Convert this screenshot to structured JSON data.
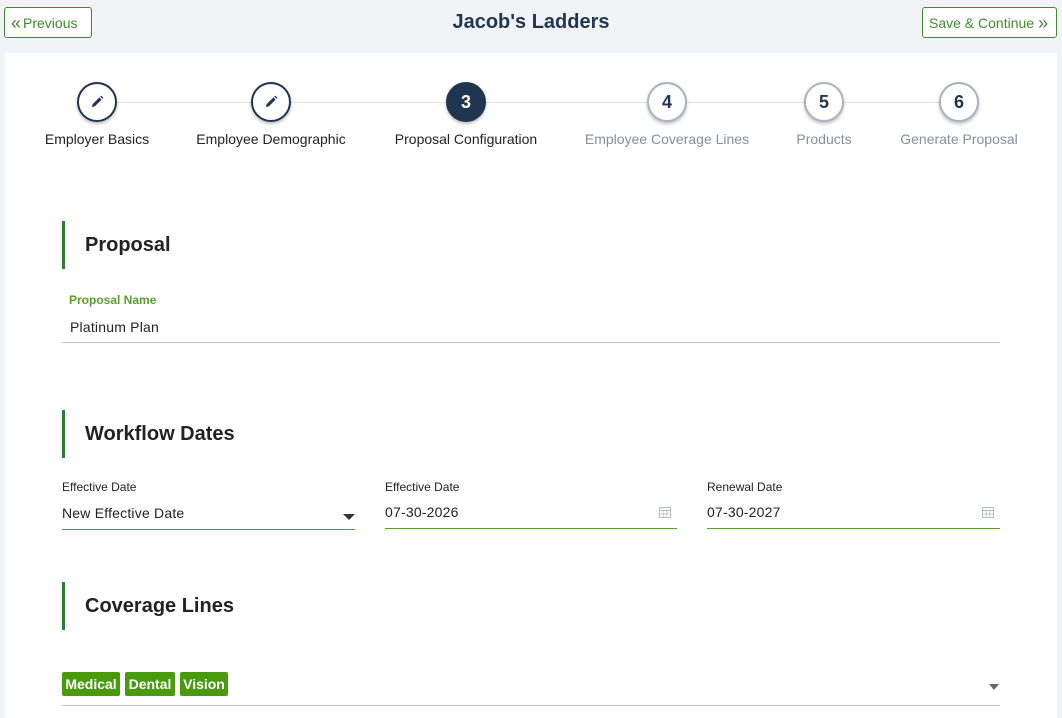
{
  "header": {
    "title": "Jacob's Ladders",
    "prev_label": "Previous",
    "next_label": "Save & Continue",
    "prev_icon": "chevrons-left-icon",
    "next_icon": "chevrons-right-icon"
  },
  "stepper": {
    "steps": [
      {
        "marker": "",
        "icon": "pencil-icon",
        "label": "Employer Basics",
        "state": "done"
      },
      {
        "marker": "",
        "icon": "pencil-icon",
        "label": "Employee Demographic",
        "state": "done"
      },
      {
        "marker": "3",
        "label": "Proposal Configuration",
        "state": "active"
      },
      {
        "marker": "4",
        "label": "Employee Coverage Lines",
        "state": "future"
      },
      {
        "marker": "5",
        "label": "Products",
        "state": "future"
      },
      {
        "marker": "6",
        "label": "Generate Proposal",
        "state": "future"
      }
    ]
  },
  "proposal": {
    "heading": "Proposal",
    "name_label": "Proposal Name",
    "name_value": "Platinum Plan"
  },
  "workflow": {
    "heading": "Workflow Dates",
    "effective_select_label": "Effective Date",
    "effective_select_value": "New Effective Date",
    "effective_date_label": "Effective Date",
    "effective_date_value": "07-30-2026",
    "renewal_date_label": "Renewal Date",
    "renewal_date_value": "07-30-2027"
  },
  "coverage": {
    "heading": "Coverage Lines",
    "chips": [
      "Medical",
      "Dental",
      "Vision"
    ]
  },
  "colors": {
    "brand_navy": "#1f3550",
    "accent_green": "#3f8a2e",
    "chip_green": "#4a9a0e"
  }
}
